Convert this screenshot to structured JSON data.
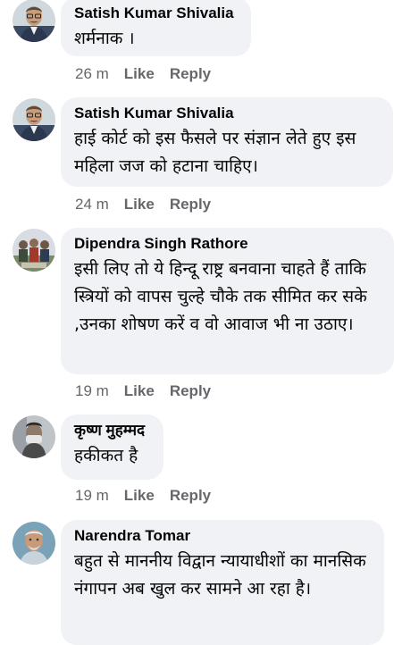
{
  "comments": [
    {
      "author": "Satish Kumar Shivalia",
      "text": "शर्मनाक ।",
      "time": "26 m",
      "like": "Like",
      "reply": "Reply",
      "avatar": "man-with-glasses-avatar"
    },
    {
      "author": "Satish Kumar Shivalia",
      "text": "हाई कोर्ट को इस फैसले पर संज्ञान लेते हुए इस महिला जज को हटाना चाहिए।",
      "time": "24 m",
      "like": "Like",
      "reply": "Reply",
      "avatar": "man-with-glasses-avatar"
    },
    {
      "author": "Dipendra Singh Rathore",
      "text": "इसी लिए तो ये हिन्दू राष्ट्र बनवाना चाहते हैं ताकि स्त्रियों को वापस चुल्हे चौके तक सीमित कर सके ,उनका शोषण करें व वो आवाज भी ना उठाए।",
      "time": "19 m",
      "like": "Like",
      "reply": "Reply",
      "avatar": "group-outdoor-avatar"
    },
    {
      "author": "कृष्ण मुहम्मद",
      "text": "हकीकत है",
      "time": "19 m",
      "like": "Like",
      "reply": "Reply",
      "avatar": "masked-face-avatar"
    },
    {
      "author": "Narendra Tomar",
      "text": "बहुत से माननीय विद्वान न्यायाधीशों का मानसिक नंगापन अब खुल कर सामने आ रहा है।",
      "time": "",
      "like": "",
      "reply": "",
      "avatar": "elderly-man-avatar"
    }
  ],
  "colors": {
    "bubble": "#f0f2f5",
    "meta": "#65676b",
    "text": "#050505"
  }
}
